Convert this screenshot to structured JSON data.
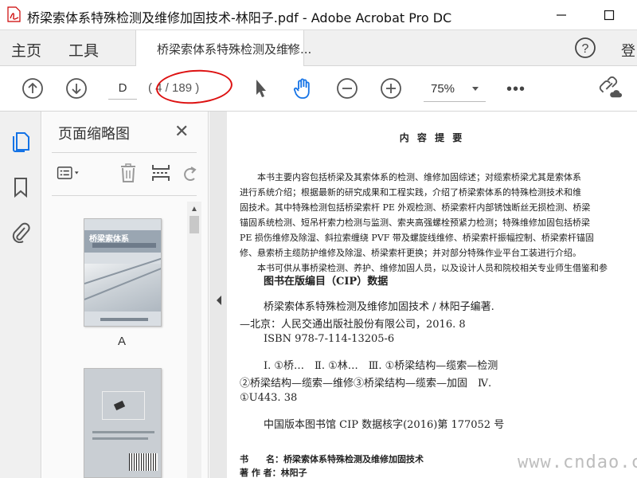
{
  "window": {
    "title": "桥梁索体系特殊检测及维修加固技术-林阳子.pdf - Adobe Acrobat Pro DC"
  },
  "menu": {
    "home": "主页",
    "tools": "工具",
    "tab_title": "桥梁索体系特殊检测及维修...",
    "tab_close": "×",
    "signin": "登"
  },
  "toolbar": {
    "page_input": "D",
    "page_total": "( 4 / 189 )",
    "zoom": "75%",
    "more": "•••"
  },
  "panel": {
    "title": "页面缩略图",
    "close": "✕",
    "thumbs": [
      {
        "cover_title": "桥梁索体系",
        "label": "A"
      }
    ]
  },
  "document": {
    "heading": "内 容 提 要",
    "summary_lines": [
      "本书主要内容包括桥梁及其索体系的检测、维修加固综述；对缆索桥梁尤其是索体系",
      "进行系统介绍；根据最新的研究成果和工程实践，介绍了桥梁索体系的特殊检测技术和维",
      "固技术。其中特殊检测包括桥梁索杆 PE 外观检测、桥梁索杆内部锈蚀断丝无损检测、桥梁",
      "锚固系统检测、短吊杆索力检测与监测、索夹高强螺栓预紧力检测；特殊维修加固包括桥梁",
      "PE 损伤维修及除湿、斜拉索缠绕 PVF 带及螺旋线维修、桥梁索杆振幅控制、桥梁索杆锚固",
      "修、悬索桥主缆防护维修及除湿、桥梁索杆更换；并对部分特殊作业平台工装进行介绍。",
      "本书可供从事桥梁检测、养护、维修加固人员，以及设计人员和院校相关专业师生借鉴和参"
    ],
    "cip_title": "图书在版编目（CIP）数据",
    "cip_lines": [
      "桥梁索体系特殊检测及维修加固技术 / 林阳子编著.",
      "—北京：人民交通出版社股份有限公司，2016. 8",
      "ISBN 978-7-114-13205-6",
      "Ⅰ. ①桥…　Ⅱ. ①林…　Ⅲ. ①桥梁结构—缆索—检测",
      "②桥梁结构—缆索—维修③桥梁结构—缆索—加固　Ⅳ.",
      "①U443. 38",
      "中国版本图书馆 CIP 数据核字(2016)第 177052 号"
    ],
    "book_name_line": "书　　名：桥梁索体系特殊检测及维修加固技术",
    "author_line": "著 作 者：林阳子"
  },
  "watermark": "www.cndao.com",
  "colors": {
    "annotation_ellipse": "#dd1111",
    "accent_blue": "#1473e6",
    "toolbar_icon": "#555555"
  },
  "icons": {
    "app": "acrobat-pdf-icon",
    "help": "question-circle-icon",
    "prev_page": "arrow-up-circle-icon",
    "next_page": "arrow-down-circle-icon",
    "select": "cursor-arrow-icon",
    "hand": "hand-pan-icon",
    "zoom_out": "minus-circle-icon",
    "zoom_in": "plus-circle-icon",
    "share": "link-cloud-icon",
    "pages": "page-thumbnails-icon",
    "bookmarks": "bookmark-icon",
    "attachments": "paperclip-icon"
  }
}
